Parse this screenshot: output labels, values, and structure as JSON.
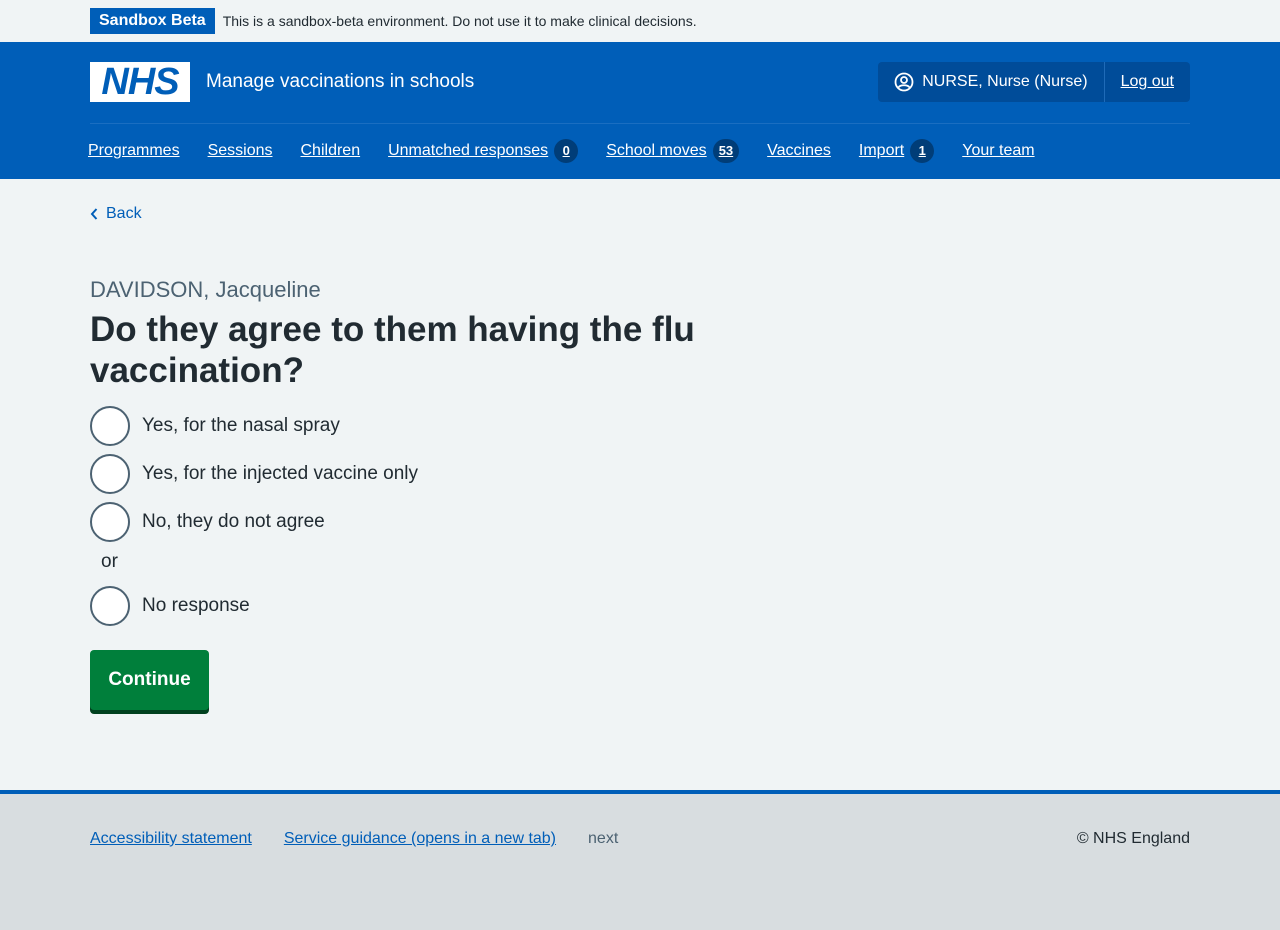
{
  "env_banner": {
    "tag": "Sandbox Beta",
    "message": "This is a sandbox-beta environment. Do not use it to make clinical decisions."
  },
  "header": {
    "logo_text": "NHS",
    "service_name": "Manage vaccinations in schools",
    "user_label": "NURSE, Nurse (Nurse)",
    "logout_label": "Log out"
  },
  "nav": {
    "items": [
      {
        "label": "Programmes"
      },
      {
        "label": "Sessions"
      },
      {
        "label": "Children"
      },
      {
        "label": "Unmatched responses",
        "badge": "0"
      },
      {
        "label": "School moves",
        "badge": "53"
      },
      {
        "label": "Vaccines"
      },
      {
        "label": "Import",
        "badge": "1"
      },
      {
        "label": "Your team"
      }
    ]
  },
  "page": {
    "back_label": "Back",
    "caption": "DAVIDSON, Jacqueline",
    "question": "Do they agree to them having the flu vaccination?",
    "options": [
      "Yes, for the nasal spray",
      "Yes, for the injected vaccine only",
      "No, they do not agree"
    ],
    "divider": "or",
    "extra_option": "No response",
    "continue_label": "Continue"
  },
  "footer": {
    "links": [
      "Accessibility statement",
      "Service guidance (opens in a new tab)"
    ],
    "version": "next",
    "copyright": "© NHS England"
  },
  "colors": {
    "brand_blue": "#005eb8",
    "button_green": "#007f3b",
    "text": "#212b32",
    "secondary_text": "#4c6272",
    "background": "#f0f4f5"
  },
  "icons": {
    "user": "user-circle-icon",
    "back": "chevron-left-icon"
  }
}
